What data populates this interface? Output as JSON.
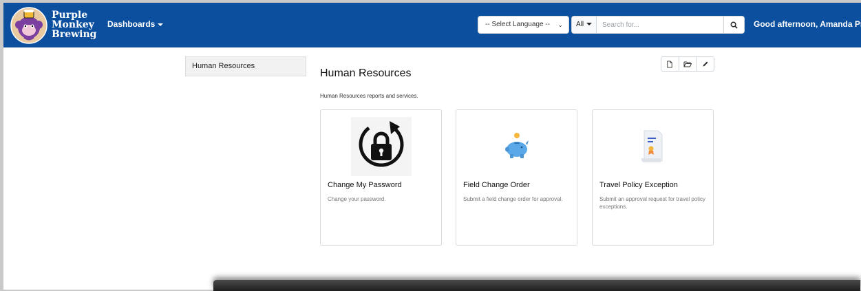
{
  "brand": {
    "name_line1": "Purple",
    "name_line2": "Monkey",
    "name_line3": "Brewing"
  },
  "navbar": {
    "dashboards_label": "Dashboards",
    "language_select_value": "-- Select Language --",
    "search_scope": "All",
    "search_placeholder": "Search for...",
    "greeting": "Good afternoon, Amanda Price",
    "bg_color": "#0b4f9e"
  },
  "sidebar": {
    "items": [
      {
        "label": "Human Resources"
      }
    ]
  },
  "toolbar": {
    "icons": [
      "new-document-icon",
      "open-folder-icon",
      "edit-pencil-icon"
    ]
  },
  "main": {
    "title": "Human Resources",
    "description": "Human Resources reports and services.",
    "cards": [
      {
        "title": "Change My Password",
        "description": "Change your password.",
        "icon": "lock-refresh-icon"
      },
      {
        "title": "Field Change Order",
        "description": "Submit a field change order for approval.",
        "icon": "piggy-bank-icon"
      },
      {
        "title": "Travel Policy Exception",
        "description": "Submit an approval request for travel policy exceptions.",
        "icon": "certificate-document-icon"
      }
    ]
  }
}
